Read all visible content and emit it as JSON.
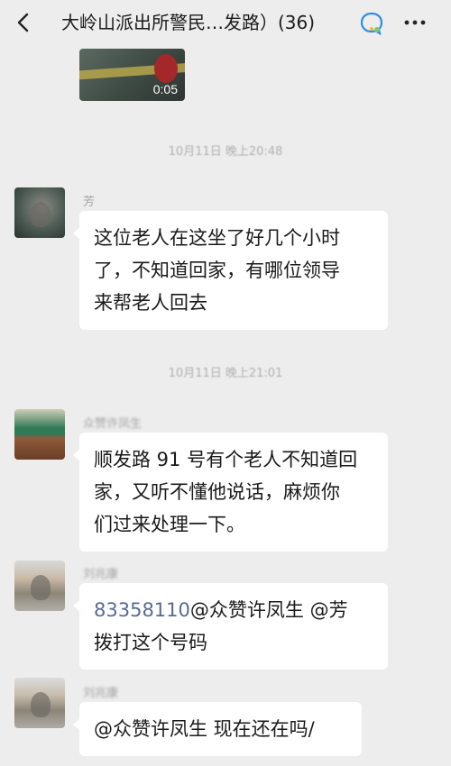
{
  "header": {
    "title": "大岭山派出所警民…发路）(36)",
    "back_icon": "chevron-left-icon",
    "chat_icon": "chat-bubble-icon",
    "more_icon": "more-dots-icon"
  },
  "video": {
    "duration": "0:05"
  },
  "messages": [
    {
      "timestamp": "10月11日 晚上20:48",
      "sender": "芳",
      "lines": [
        "这位老人在这坐了好几个小时",
        "了，不知道回家，有哪位领导",
        "来帮老人回去"
      ]
    },
    {
      "timestamp": "10月11日 晚上21:01",
      "sender": "众赞许凤生",
      "lines": [
        "顺发路 91 号有个老人不知道回",
        "家，又听不懂他说话，麻烦你",
        "们过来处理一下。"
      ]
    },
    {
      "sender": "刘兆康",
      "phone": "83358110",
      "line1_rest": "@众赞许凤生  @芳",
      "line2": "拨打这个号码"
    },
    {
      "sender": "刘兆康",
      "text": "@众赞许凤生  现在还在吗/"
    }
  ]
}
